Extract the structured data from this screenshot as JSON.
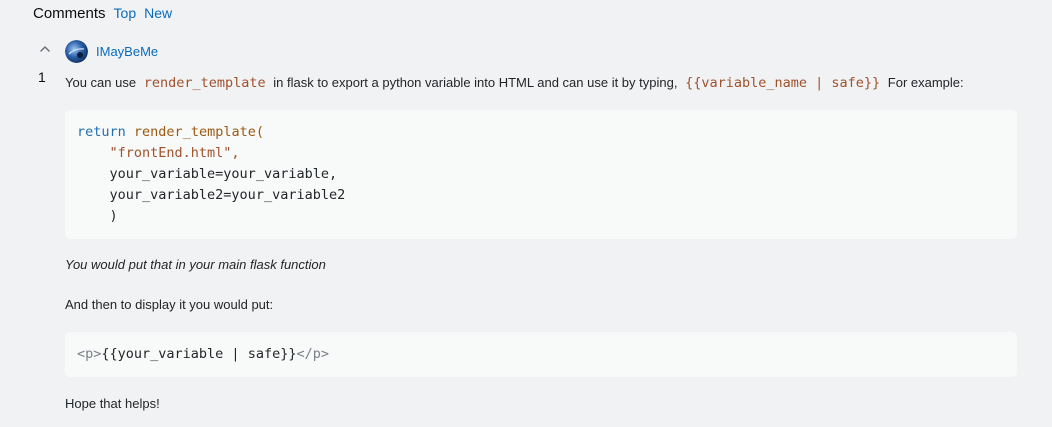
{
  "header": {
    "title": "Comments",
    "sort_top": "Top",
    "sort_new": "New"
  },
  "comment": {
    "score": "1",
    "author": "IMayBeMe",
    "p1": {
      "t1": "You can use",
      "c1": "render_template",
      "t2": "in flask to export a python variable into HTML and can use it by typing,",
      "c2": "{{variable_name | safe}}",
      "t3": "For example:"
    },
    "code1": {
      "l1_kw": "return",
      "l1_fn": "render_template(",
      "l2": "\"frontEnd.html\",",
      "l3": "your_variable=your_variable,",
      "l4": "your_variable2=your_variable2",
      "l5": ")"
    },
    "p2": "You would put that in your main flask function",
    "p3": "And then to display it you would put:",
    "code2": {
      "open": "<p>",
      "body": "{{your_variable | safe}}",
      "close": "</p>"
    },
    "p4": "Hope that helps!"
  },
  "colors": {
    "link": "#0a6bbd",
    "code": "#a0522d",
    "keyword": "#1f6fb2",
    "codebg": "#f8f9f9"
  },
  "icons": {
    "vote": "chevron-up-icon",
    "avatar": "avatar-image"
  }
}
